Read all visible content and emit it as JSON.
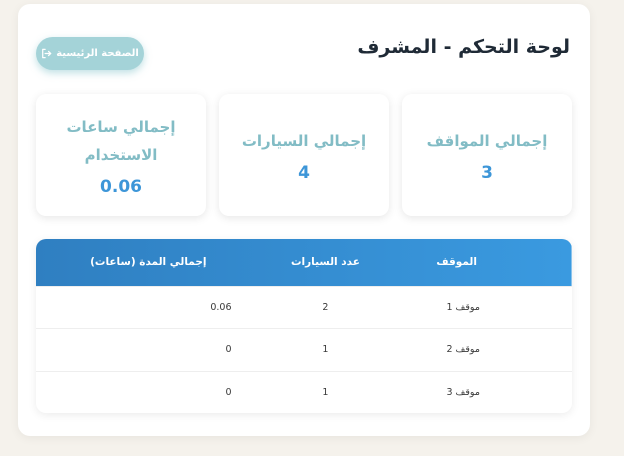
{
  "header": {
    "title": "لوحة التحكم - المشرف",
    "home_button": "الصفحة الرئيسية"
  },
  "stats": [
    {
      "label": "إجمالي المواقف",
      "value": "3"
    },
    {
      "label": "إجمالي السيارات",
      "value": "4"
    },
    {
      "label": "إجمالي ساعات الاستخدام",
      "value": "0.06"
    }
  ],
  "table": {
    "headers": [
      "الموقف",
      "عدد السيارات",
      "إجمالي المدة (ساعات)"
    ],
    "rows": [
      [
        "موقف 1",
        "2",
        "0.06"
      ],
      [
        "موقف 2",
        "1",
        "0"
      ],
      [
        "موقف 3",
        "1",
        "0"
      ]
    ]
  },
  "colors": {
    "accent": "#3d96d8",
    "button": "#a4d3d8",
    "card_label": "#82bcc5",
    "background": "#f5f2ec"
  },
  "icons": {
    "home_button_icon": "sign-out-icon"
  }
}
